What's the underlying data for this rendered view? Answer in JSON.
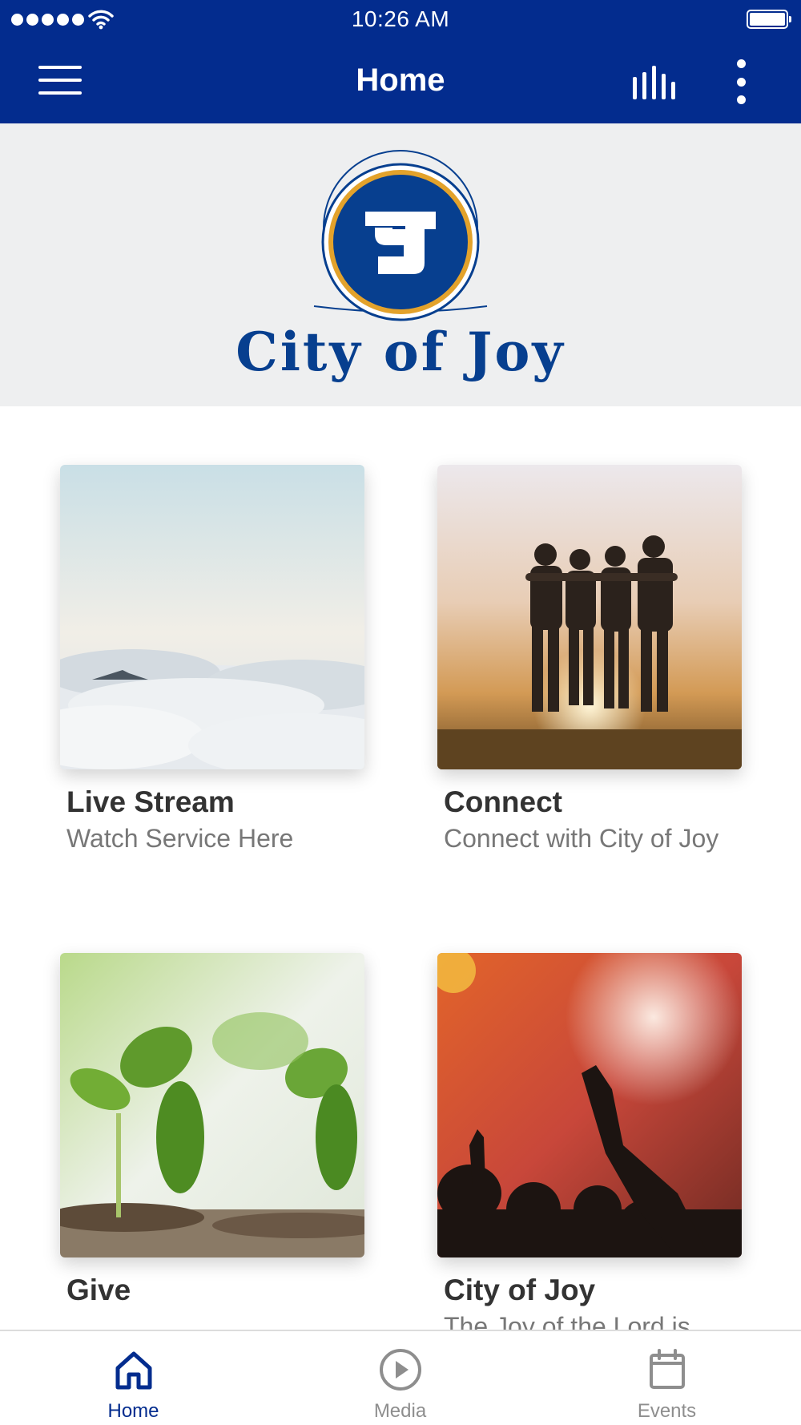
{
  "status_bar": {
    "time": "10:26 AM"
  },
  "nav_bar": {
    "title": "Home",
    "background_color": "#032c8e"
  },
  "hero": {
    "logo_text": "City of Joy",
    "brand_color": "#073f8f",
    "accent_color": "#e3a22b"
  },
  "cards": [
    {
      "title": "Live Stream",
      "subtitle": "Watch Service Here"
    },
    {
      "title": "Connect",
      "subtitle": "Connect with City of Joy"
    },
    {
      "title": "Give",
      "subtitle": ""
    },
    {
      "title": "City of Joy",
      "subtitle": "The Joy of the Lord is my strength"
    }
  ],
  "tab_bar": {
    "active_color": "#032c8e",
    "inactive_color": "#8e8e8e",
    "tabs": [
      {
        "label": "Home",
        "icon": "home-icon",
        "active": true
      },
      {
        "label": "Media",
        "icon": "play-circle-icon",
        "active": false
      },
      {
        "label": "Events",
        "icon": "calendar-icon",
        "active": false
      }
    ]
  }
}
